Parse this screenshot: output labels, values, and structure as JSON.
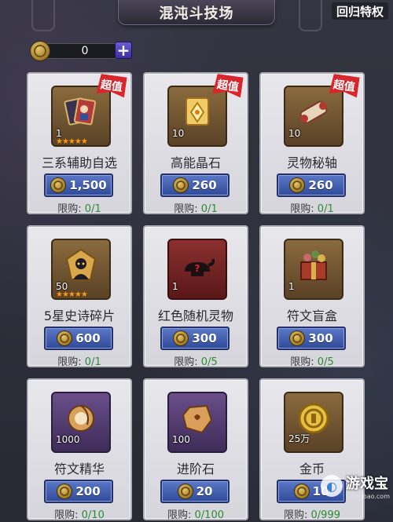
{
  "header": {
    "title": "混沌斗技场",
    "return_label": "回归特权"
  },
  "currency": {
    "amount": "0",
    "add_label": "+",
    "icon": "coin-icon"
  },
  "items": [
    {
      "name": "三系辅助自选",
      "qty": "1",
      "stars": "★★★★★",
      "badge": "超值",
      "price": "1,500",
      "limit_label": "限购:",
      "limit_value": "0/1",
      "frame": "gold",
      "icon": "portrait-cards-icon"
    },
    {
      "name": "高能晶石",
      "qty": "10",
      "stars": "",
      "badge": "超值",
      "price": "260",
      "limit_label": "限购:",
      "limit_value": "0/1",
      "frame": "gold",
      "icon": "crystal-scroll-icon"
    },
    {
      "name": "灵物秘轴",
      "qty": "10",
      "stars": "",
      "badge": "超值",
      "price": "260",
      "limit_label": "限购:",
      "limit_value": "0/1",
      "frame": "gold",
      "icon": "scroll-icon"
    },
    {
      "name": "5星史诗碎片",
      "qty": "50",
      "stars": "★★★★★",
      "badge": "",
      "price": "600",
      "limit_label": "限购:",
      "limit_value": "0/1",
      "frame": "gold",
      "icon": "hero-shard-icon"
    },
    {
      "name": "红色随机灵物",
      "qty": "1",
      "stars": "",
      "badge": "",
      "price": "300",
      "limit_label": "限购:",
      "limit_value": "0/5",
      "frame": "red",
      "icon": "mystery-lamp-icon"
    },
    {
      "name": "符文盲盒",
      "qty": "1",
      "stars": "",
      "badge": "",
      "price": "300",
      "limit_label": "限购:",
      "limit_value": "0/5",
      "frame": "gold",
      "icon": "gift-box-icon"
    },
    {
      "name": "符文精华",
      "qty": "1000",
      "stars": "",
      "badge": "",
      "price": "200",
      "limit_label": "限购:",
      "limit_value": "0/10",
      "frame": "purple",
      "icon": "rune-essence-icon"
    },
    {
      "name": "进阶石",
      "qty": "100",
      "stars": "",
      "badge": "",
      "price": "20",
      "limit_label": "限购:",
      "limit_value": "0/100",
      "frame": "purple",
      "icon": "advance-stone-icon"
    },
    {
      "name": "金币",
      "qty": "25万",
      "stars": "",
      "badge": "",
      "price": "10",
      "limit_label": "限购:",
      "limit_value": "0/999",
      "frame": "gold",
      "icon": "gold-coin-icon"
    }
  ],
  "watermark": {
    "cn": "游戏宝",
    "en": "youxibao.com"
  }
}
